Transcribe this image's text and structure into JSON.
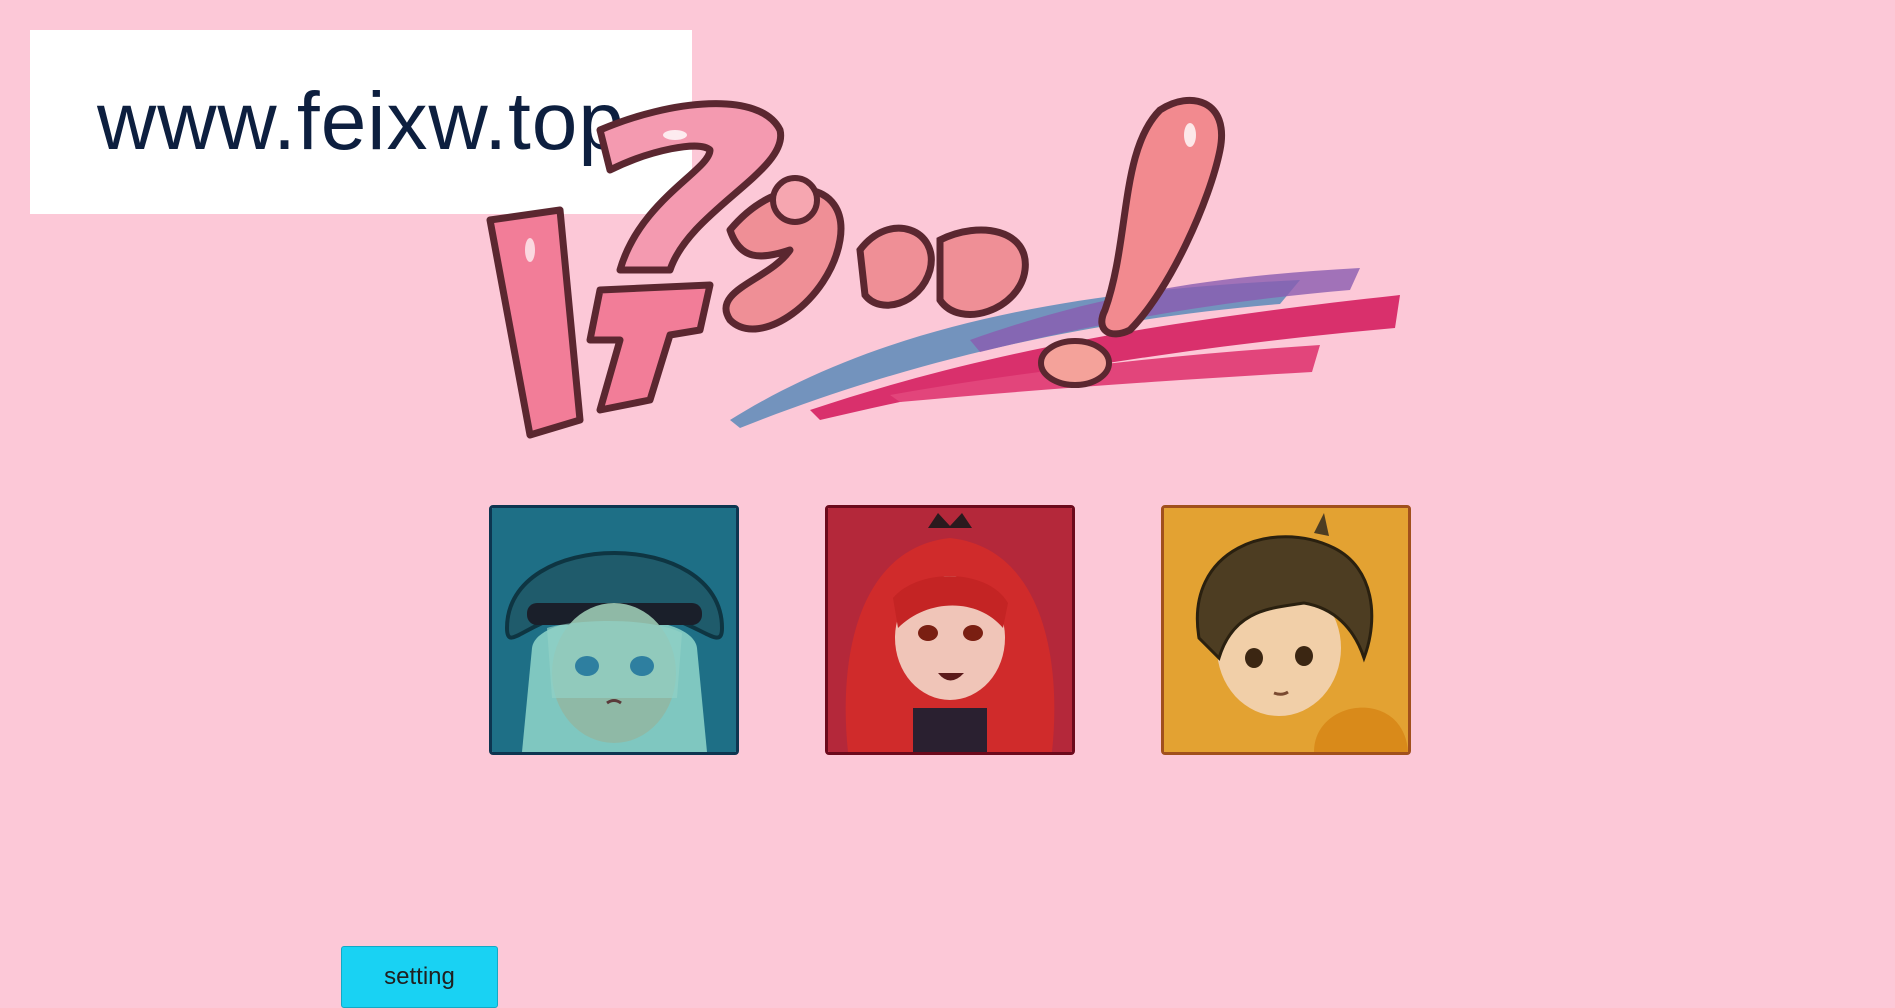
{
  "watermark": {
    "text": "www.feixw.top"
  },
  "logo": {
    "text": "ドスケベ！",
    "icon": "game-title-logo"
  },
  "characters": [
    {
      "name": "teal-haired-girl",
      "accent": "#1f6a82"
    },
    {
      "name": "red-haired-girl",
      "accent": "#b01f34"
    },
    {
      "name": "brown-haired-boy",
      "accent": "#e0a12a"
    }
  ],
  "buttons": {
    "setting_label": "setting"
  },
  "colors": {
    "background": "#fcc8d7",
    "button": "#19d2f3"
  }
}
